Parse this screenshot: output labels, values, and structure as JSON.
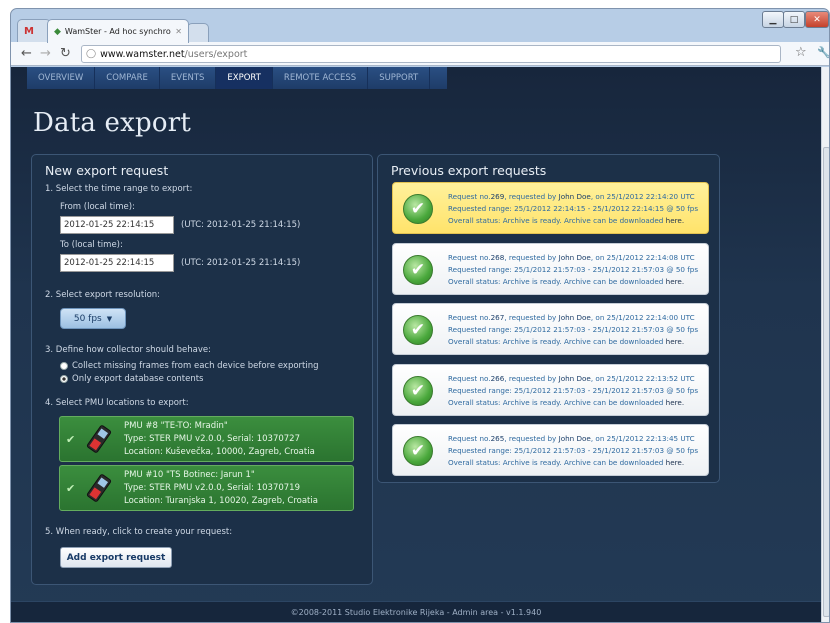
{
  "browser": {
    "tabs": [
      {
        "label": "M"
      },
      {
        "label": "WamSter - Ad hoc synchro"
      }
    ],
    "url_host": "www.wamster.net",
    "url_path": "/users/export"
  },
  "nav": {
    "items": [
      "OVERVIEW",
      "COMPARE",
      "EVENTS",
      "EXPORT",
      "REMOTE ACCESS",
      "SUPPORT"
    ],
    "active": "EXPORT"
  },
  "page": {
    "title": "Data export"
  },
  "new_request": {
    "title": "New export request",
    "step1": "1. Select the time range to export:",
    "from_label": "From (local time):",
    "from_value": "2012-01-25 22:14:15",
    "from_utc": "(UTC: 2012-01-25 21:14:15)",
    "to_label": "To (local time):",
    "to_value": "2012-01-25 22:14:15",
    "to_utc": "(UTC: 2012-01-25 21:14:15)",
    "step2": "2. Select export resolution:",
    "resolution": "50 fps",
    "step3": "3. Define how collector should behave:",
    "option1": "Collect missing frames from each device before exporting",
    "option2": "Only export database contents",
    "selected_option": 2,
    "step4": "4. Select PMU locations to export:",
    "pmus": [
      {
        "name": "PMU #8 \"TE-TO: Mradin\"",
        "type": "Type: STER PMU v2.0.0, Serial: 10370727",
        "location": "Location: Kuševečka, 10000, Zagreb, Croatia"
      },
      {
        "name": "PMU #10 \"TS Botinec: Jarun 1\"",
        "type": "Type: STER PMU v2.0.0, Serial: 10370719",
        "location": "Location: Turanjska 1, 10020, Zagreb, Croatia"
      }
    ],
    "step5": "5. When ready, click to create your request:",
    "button": "Add export request"
  },
  "previous": {
    "title": "Previous export requests",
    "items": [
      {
        "no": "269",
        "user": "John Doe",
        "on": "25/1/2012 22:14:20 UTC",
        "range": "25/1/2012 22:14:15 - 25/1/2012 22:14:15 @ 50 fps",
        "highlighted": true
      },
      {
        "no": "268",
        "user": "John Doe",
        "on": "25/1/2012 22:14:08 UTC",
        "range": "25/1/2012 21:57:03 - 25/1/2012 21:57:03 @ 50 fps",
        "highlighted": false
      },
      {
        "no": "267",
        "user": "John Doe",
        "on": "25/1/2012 22:14:00 UTC",
        "range": "25/1/2012 21:57:03 - 25/1/2012 21:57:03 @ 50 fps",
        "highlighted": false
      },
      {
        "no": "266",
        "user": "John Doe",
        "on": "25/1/2012 22:13:52 UTC",
        "range": "25/1/2012 21:57:03 - 25/1/2012 21:57:03 @ 50 fps",
        "highlighted": false
      },
      {
        "no": "265",
        "user": "John Doe",
        "on": "25/1/2012 22:13:45 UTC",
        "range": "25/1/2012 21:57:03 - 25/1/2012 21:57:03 @ 50 fps",
        "highlighted": false
      }
    ],
    "status_text": "Overall status: Archive is ready. Archive can be downloaded",
    "here": "here."
  },
  "footer": {
    "text": "©2008-2011 Studio Elektronike Rijeka - Admin area - v1.1.940"
  }
}
